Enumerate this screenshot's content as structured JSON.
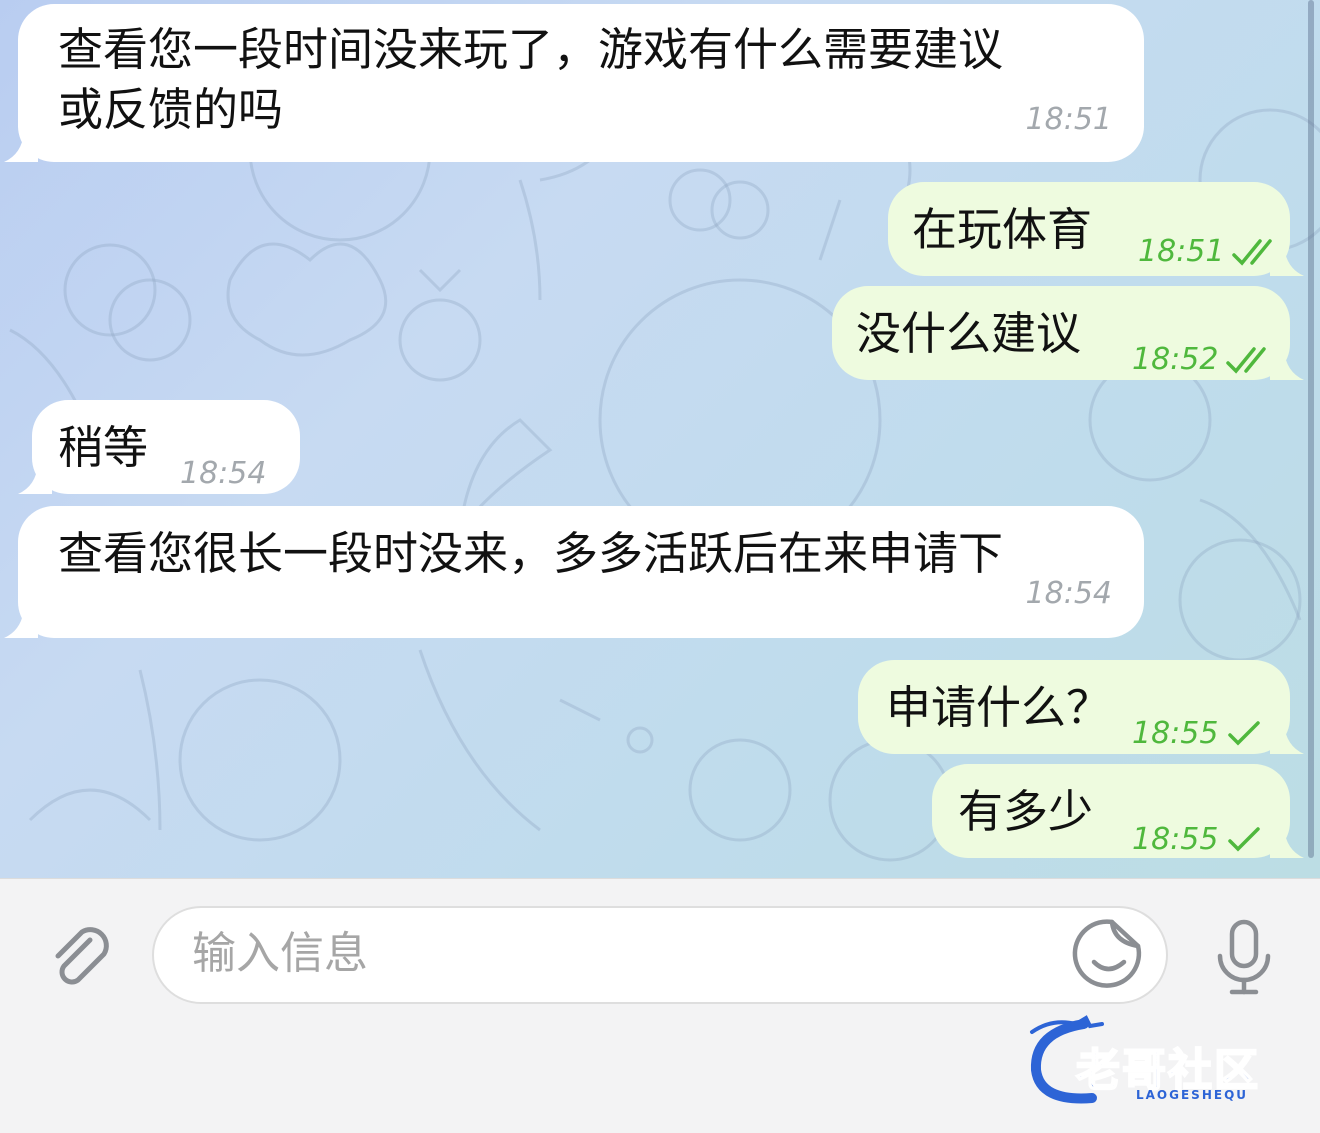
{
  "messages": [
    {
      "direction": "incoming",
      "text": "查看您一段时间没来玩了，游戏有什么需要建议\n或反馈的吗",
      "time": "18:51"
    },
    {
      "direction": "outgoing",
      "text": "在玩体育",
      "time": "18:51",
      "status": "read"
    },
    {
      "direction": "outgoing",
      "text": "没什么建议",
      "time": "18:52",
      "status": "read"
    },
    {
      "direction": "incoming",
      "text": "稍等",
      "time": "18:54"
    },
    {
      "direction": "incoming",
      "text": "查看您很长一段时没来，多多活跃后在来申请下",
      "time": "18:54"
    },
    {
      "direction": "outgoing",
      "text": "申请什么？",
      "time": "18:55",
      "status": "sent"
    },
    {
      "direction": "outgoing",
      "text": "有多少",
      "time": "18:55",
      "status": "sent"
    }
  ],
  "composer": {
    "placeholder": "输入信息",
    "attach_icon": "paperclip-icon",
    "sticker_icon": "sticker-icon",
    "mic_icon": "microphone-icon"
  },
  "watermark": {
    "main": "老哥社区",
    "sub": "LAOGESHEQU"
  },
  "colors": {
    "incoming_bubble": "#ffffff",
    "outgoing_bubble": "#eefbdf",
    "outgoing_meta": "#4fb83d",
    "incoming_meta": "#a3a8ad",
    "composer_bg": "#f3f3f4"
  }
}
